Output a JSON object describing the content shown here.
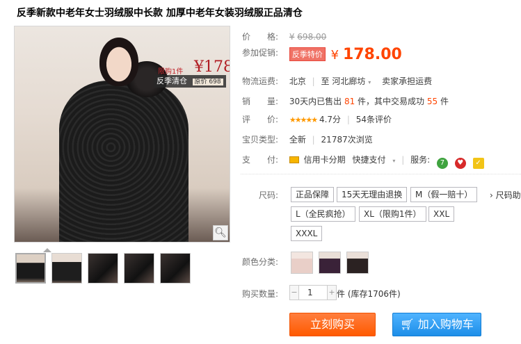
{
  "product": {
    "title": "反季新款中老年女士羽绒服中长款 加厚中老年女装羽绒服正品清仓"
  },
  "image": {
    "promo_limit": "限购1件",
    "promo_price": "¥178",
    "promo_tag": "反季清仓",
    "promo_orig": "原价 698",
    "thumbnail_count": 5,
    "selected_thumbnail": 1
  },
  "price": {
    "label": "价　　格:",
    "currency": "¥",
    "original": "698.00"
  },
  "promotion": {
    "label": "参加促销:",
    "badge": "反季特价",
    "currency": "¥",
    "price": "178.00"
  },
  "shipping": {
    "label": "物流运费:",
    "from": "北京",
    "to_prefix": "至",
    "to": "河北廊坊",
    "fee": "卖家承担运费"
  },
  "sales": {
    "label": "销　　量:",
    "prefix": "30天内已售出",
    "sold": "81",
    "middle": "件，其中交易成功",
    "success": "55",
    "suffix": "件"
  },
  "rating": {
    "label": "评　　价:",
    "stars": 4.7,
    "score": "4.7分",
    "count": "54条评价"
  },
  "type": {
    "label": "宝贝类型:",
    "value": "全新",
    "views": "21787次浏览"
  },
  "payment": {
    "label": "支　　付:",
    "credit": "信用卡分期",
    "quick": "快捷支付",
    "service_label": "服务:"
  },
  "size": {
    "label": "尺码:",
    "options": [
      "正品保障",
      "15天无理由退换",
      "M（假一赔十）",
      "L（全民疯抢）",
      "XL（限购1件）",
      "XXL",
      "XXXL"
    ],
    "more": "尺码助"
  },
  "color": {
    "label": "颜色分类:",
    "swatch_colors": [
      "#e9cfc8",
      "#3a2238",
      "#2b2222"
    ]
  },
  "quantity": {
    "label": "购买数量:",
    "value": "1",
    "stock": "件 (库存1706件)"
  },
  "actions": {
    "buy": "立刻购买",
    "cart": "加入购物车"
  },
  "colors": {
    "accent": "#ff4400",
    "buy_button": "#ff5a00",
    "cart_button": "#1d8ee8"
  }
}
